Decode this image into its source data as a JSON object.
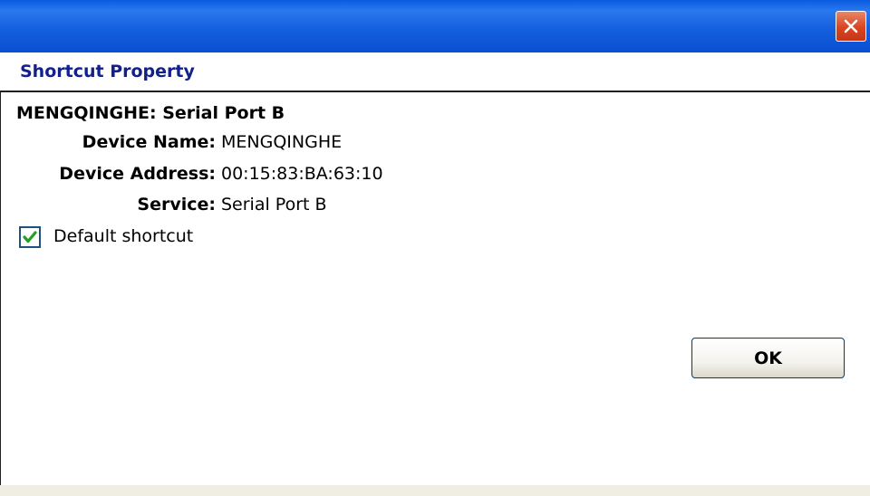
{
  "window": {
    "close_icon": "close-icon"
  },
  "header": {
    "title": "Shortcut Property"
  },
  "content": {
    "heading": "MENGQINGHE: Serial Port B",
    "properties": [
      {
        "label": "Device Name:",
        "value": "MENGQINGHE"
      },
      {
        "label": "Device Address:",
        "value": "00:15:83:BA:63:10"
      },
      {
        "label": "Service:",
        "value": "Serial Port B"
      }
    ],
    "default_shortcut": {
      "label": "Default shortcut",
      "checked": true
    },
    "ok_label": "OK"
  },
  "colors": {
    "titlebar": "#0a5be0",
    "header_text": "#12208c",
    "close_button": "#d8451f",
    "checkmark": "#21a121"
  }
}
